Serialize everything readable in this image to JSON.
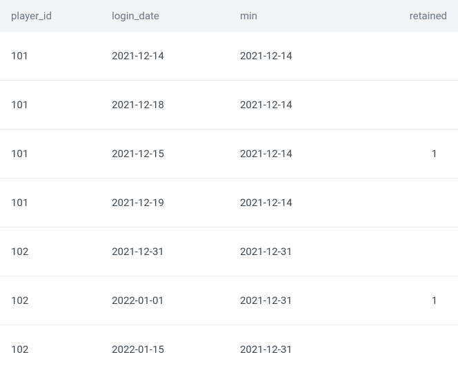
{
  "table": {
    "headers": {
      "player_id": "player_id",
      "login_date": "login_date",
      "min": "min",
      "retained": "retained"
    },
    "rows": [
      {
        "player_id": "101",
        "login_date": "2021-12-14",
        "min": "2021-12-14",
        "retained": ""
      },
      {
        "player_id": "101",
        "login_date": "2021-12-18",
        "min": "2021-12-14",
        "retained": ""
      },
      {
        "player_id": "101",
        "login_date": "2021-12-15",
        "min": "2021-12-14",
        "retained": "1"
      },
      {
        "player_id": "101",
        "login_date": "2021-12-19",
        "min": "2021-12-14",
        "retained": ""
      },
      {
        "player_id": "102",
        "login_date": "2021-12-31",
        "min": "2021-12-31",
        "retained": ""
      },
      {
        "player_id": "102",
        "login_date": "2022-01-01",
        "min": "2021-12-31",
        "retained": "1"
      },
      {
        "player_id": "102",
        "login_date": "2022-01-15",
        "min": "2021-12-31",
        "retained": ""
      }
    ]
  }
}
